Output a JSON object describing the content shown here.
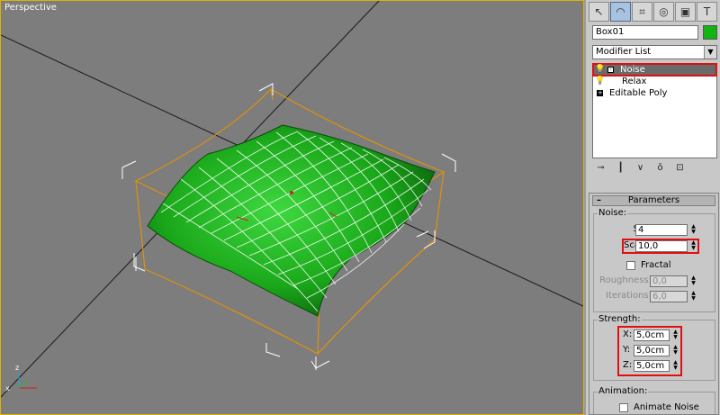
{
  "viewport": {
    "label": "Perspective"
  },
  "panel": {
    "toolbar": [
      "create-icon",
      "modify-icon",
      "hierarchy-icon",
      "motion-icon",
      "display-icon",
      "utilities-icon"
    ],
    "object_name": "Box01",
    "object_color": "#11b511",
    "modifier_list_label": "Modifier List",
    "stack": [
      {
        "label": "Noise",
        "selected": true
      },
      {
        "label": "Relax",
        "selected": false
      },
      {
        "label": "Editable Poly",
        "selected": false
      }
    ],
    "parameters": {
      "title": "Parameters",
      "noise_group": "Noise:",
      "seed_label": "Seed:",
      "seed_value": "4",
      "scale_label": "Scale:",
      "scale_value": "10,0",
      "fractal_label": "Fractal",
      "roughness_label": "Roughness:",
      "roughness_value": "0,0",
      "iterations_label": "Iterations:",
      "iterations_value": "6,0",
      "strength_group": "Strength:",
      "x_label": "X:",
      "x_value": "5,0cm",
      "y_label": "Y:",
      "y_value": "5,0cm",
      "z_label": "Z:",
      "z_value": "5,0cm",
      "animation_group": "Animation:",
      "animate_noise_label": "Animate Noise"
    }
  },
  "colors": {
    "viewport_bg": "#7d7d7d",
    "mesh_green": "#1fa51f",
    "bbox_orange": "#e0900a",
    "highlight_red": "#e01010"
  }
}
